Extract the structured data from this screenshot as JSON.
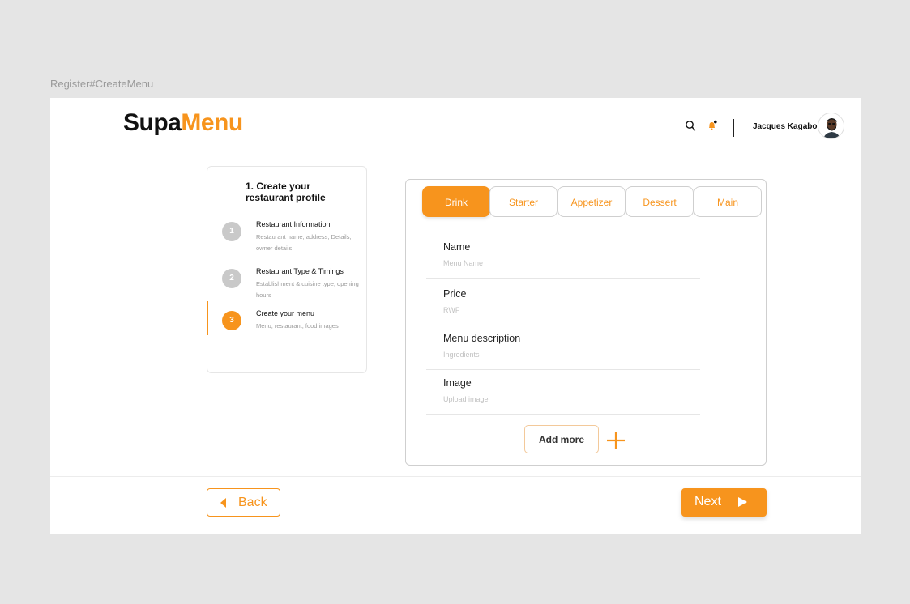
{
  "frame_label": "Register#CreateMenu",
  "header": {
    "logo_part1": "Supa",
    "logo_part2": "Menu",
    "user_name": "Jacques Kagabo"
  },
  "stepper": {
    "title": "1. Create your restaurant profile",
    "steps": [
      {
        "number": "1",
        "title": "Restaurant Information",
        "description": "Restaurant name, address, Details, owner details"
      },
      {
        "number": "2",
        "title": "Restaurant Type & Timings",
        "description": "Establishment & cuisine type, opening hours"
      },
      {
        "number": "3",
        "title": "Create your menu",
        "description": "Menu, restaurant, food images"
      }
    ]
  },
  "menu_form": {
    "tabs": [
      {
        "label": "Drink",
        "active": true
      },
      {
        "label": "Starter"
      },
      {
        "label": "Appetizer"
      },
      {
        "label": "Dessert"
      },
      {
        "label": "Main"
      }
    ],
    "fields": [
      {
        "label": "Name",
        "placeholder": "Menu Name"
      },
      {
        "label": "Price",
        "placeholder": "RWF"
      },
      {
        "label": "Menu description",
        "placeholder": "Ingredients"
      },
      {
        "label": "Image",
        "placeholder": "Upload image"
      }
    ],
    "add_more_label": "Add more"
  },
  "footer": {
    "back_label": "Back",
    "next_label": "Next"
  },
  "colors": {
    "accent": "#f7941d",
    "text": "#111111",
    "muted": "#9a9a9a",
    "background": "#e5e5e5"
  },
  "icons": [
    "search-icon",
    "bell-icon",
    "avatar",
    "plus-icon",
    "arrow-left-icon",
    "play-right-icon"
  ]
}
